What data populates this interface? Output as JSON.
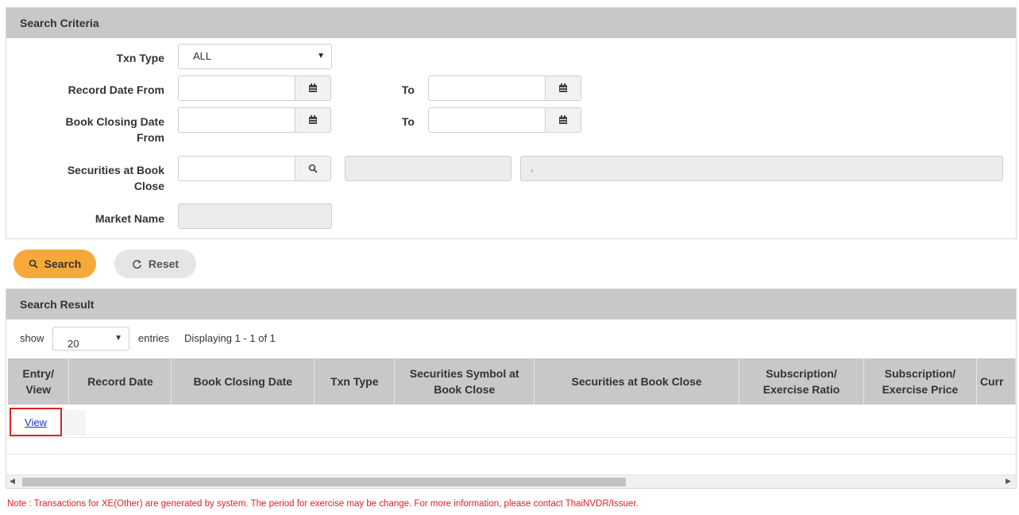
{
  "criteria": {
    "title": "Search Criteria",
    "txn_type_label": "Txn Type",
    "txn_type_value": "ALL",
    "record_date_from_label": "Record Date From",
    "record_date_to_label": "To",
    "book_closing_from_label_1": "Book Closing Date",
    "book_closing_from_label_2": "From",
    "book_closing_to_label": "To",
    "securities_label_1": "Securities at Book",
    "securities_label_2": "Close",
    "securities_secondary_value": ",",
    "market_name_label": "Market Name"
  },
  "buttons": {
    "search": "Search",
    "reset": "Reset"
  },
  "result": {
    "title": "Search Result",
    "show_label": "show",
    "page_size": "20",
    "entries_label": "entries",
    "displaying": "Displaying 1 - 1 of 1",
    "columns": [
      "Entry/ View",
      "Record Date",
      "Book Closing Date",
      "Txn Type",
      "Securities Symbol at Book Close",
      "Securities at Book Close",
      "Subscription/ Exercise Ratio",
      "Subscription/ Exercise Price",
      "Curr"
    ],
    "rows": [
      {
        "link": "View"
      }
    ]
  },
  "note": "Note : Transactions for XE(Other) are generated by system. The period for exercise may be change. For more information, please contact ThaiNVDR/Issuer.",
  "colors": {
    "header_bg": "#c8c8c8",
    "search_button": "#f6a93a",
    "reset_button": "#e5e5e5",
    "note_text": "#e0222a",
    "link": "#1a33c8",
    "highlight_border": "#e02020"
  }
}
